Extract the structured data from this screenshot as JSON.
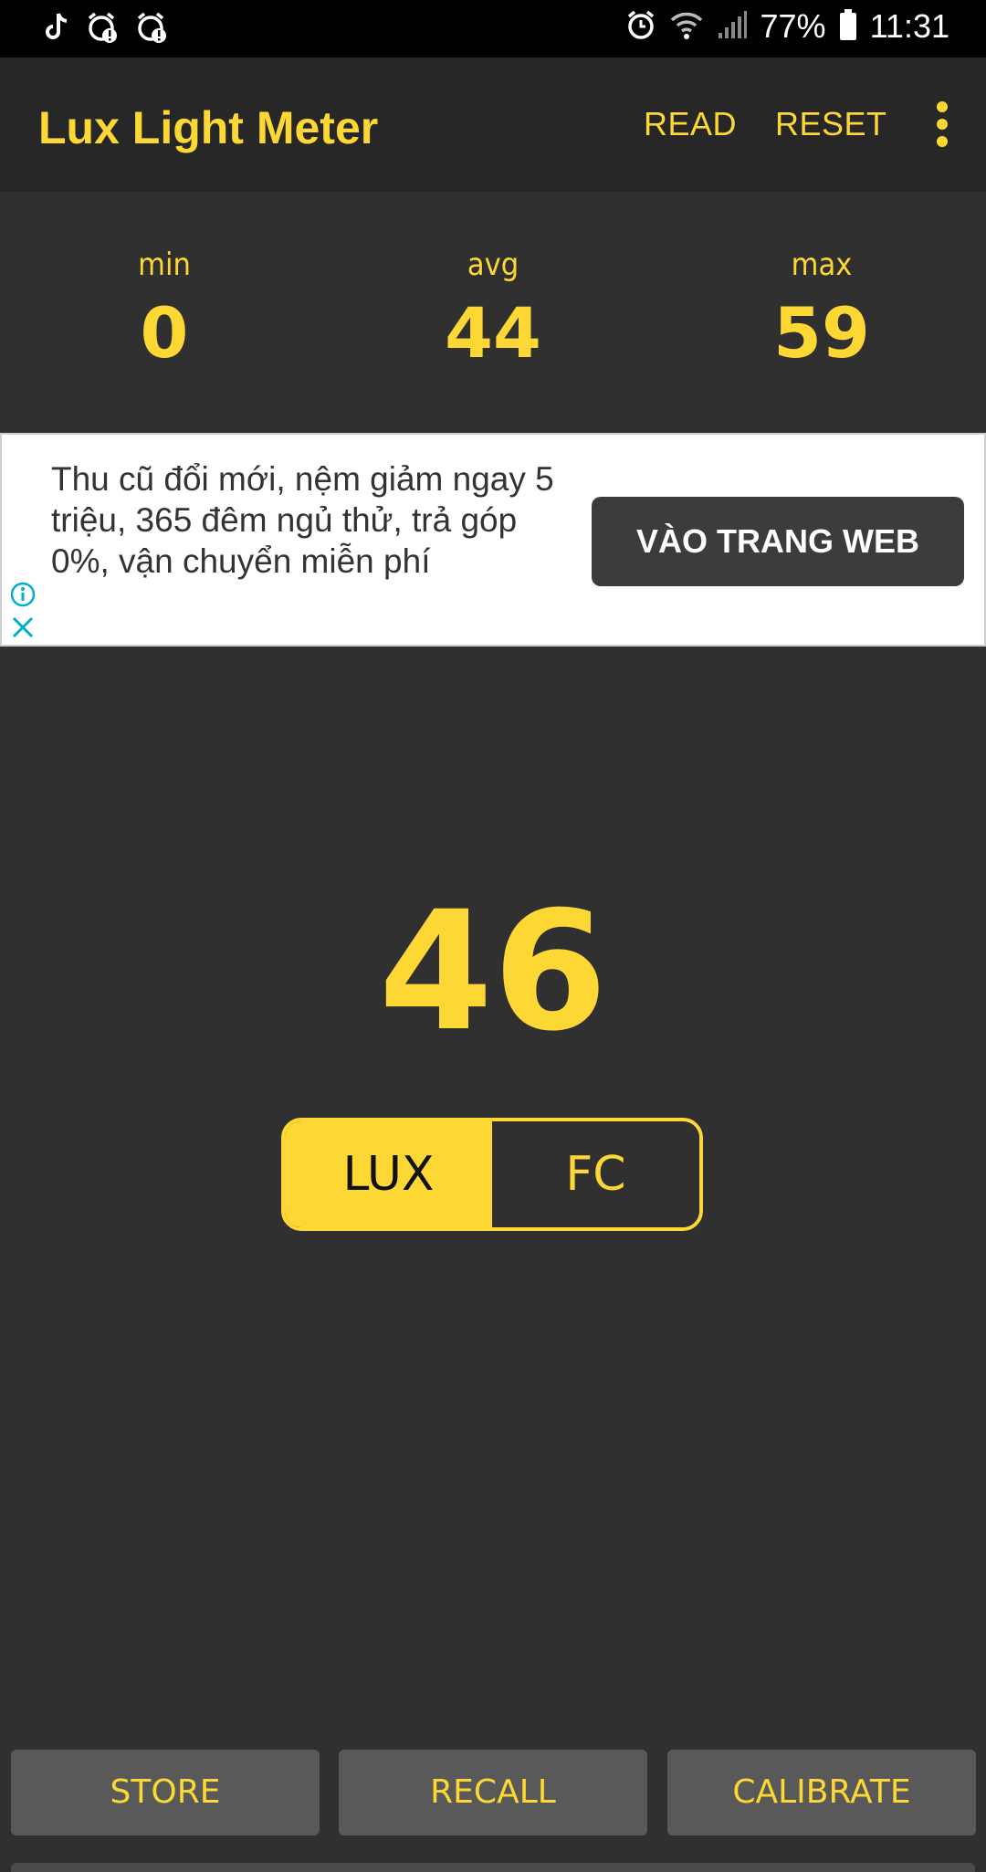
{
  "status_bar": {
    "battery": "77%",
    "time": "11:31",
    "icons": [
      "tiktok-icon",
      "alarm-alert-icon",
      "alarm-alert-icon",
      "alarm-icon",
      "wifi-icon",
      "signal-icon",
      "battery-icon"
    ]
  },
  "app_bar": {
    "title": "Lux Light Meter",
    "read_label": "READ",
    "reset_label": "RESET",
    "menu_icon": "more-vert-icon"
  },
  "stats": {
    "min_label": "min",
    "min_value": "0",
    "avg_label": "avg",
    "avg_value": "44",
    "max_label": "max",
    "max_value": "59"
  },
  "ad": {
    "text": "Thu cũ đổi mới, nệm giảm ngay 5 triệu, 365 đêm ngủ thử, trả góp 0%, vận chuyển miễn phí",
    "button_label": "VÀO TRANG WEB",
    "info_icon": "info-icon",
    "close_icon": "close-icon"
  },
  "reading": {
    "value": "46"
  },
  "unit_toggle": {
    "lux_label": "LUX",
    "fc_label": "FC",
    "selected": "LUX"
  },
  "bottom_buttons": {
    "store_label": "STORE",
    "recall_label": "RECALL",
    "calibrate_label": "CALIBRATE"
  },
  "colors": {
    "accent": "#FDD835",
    "background": "#303030",
    "appbar": "#272727",
    "button": "#595959"
  }
}
